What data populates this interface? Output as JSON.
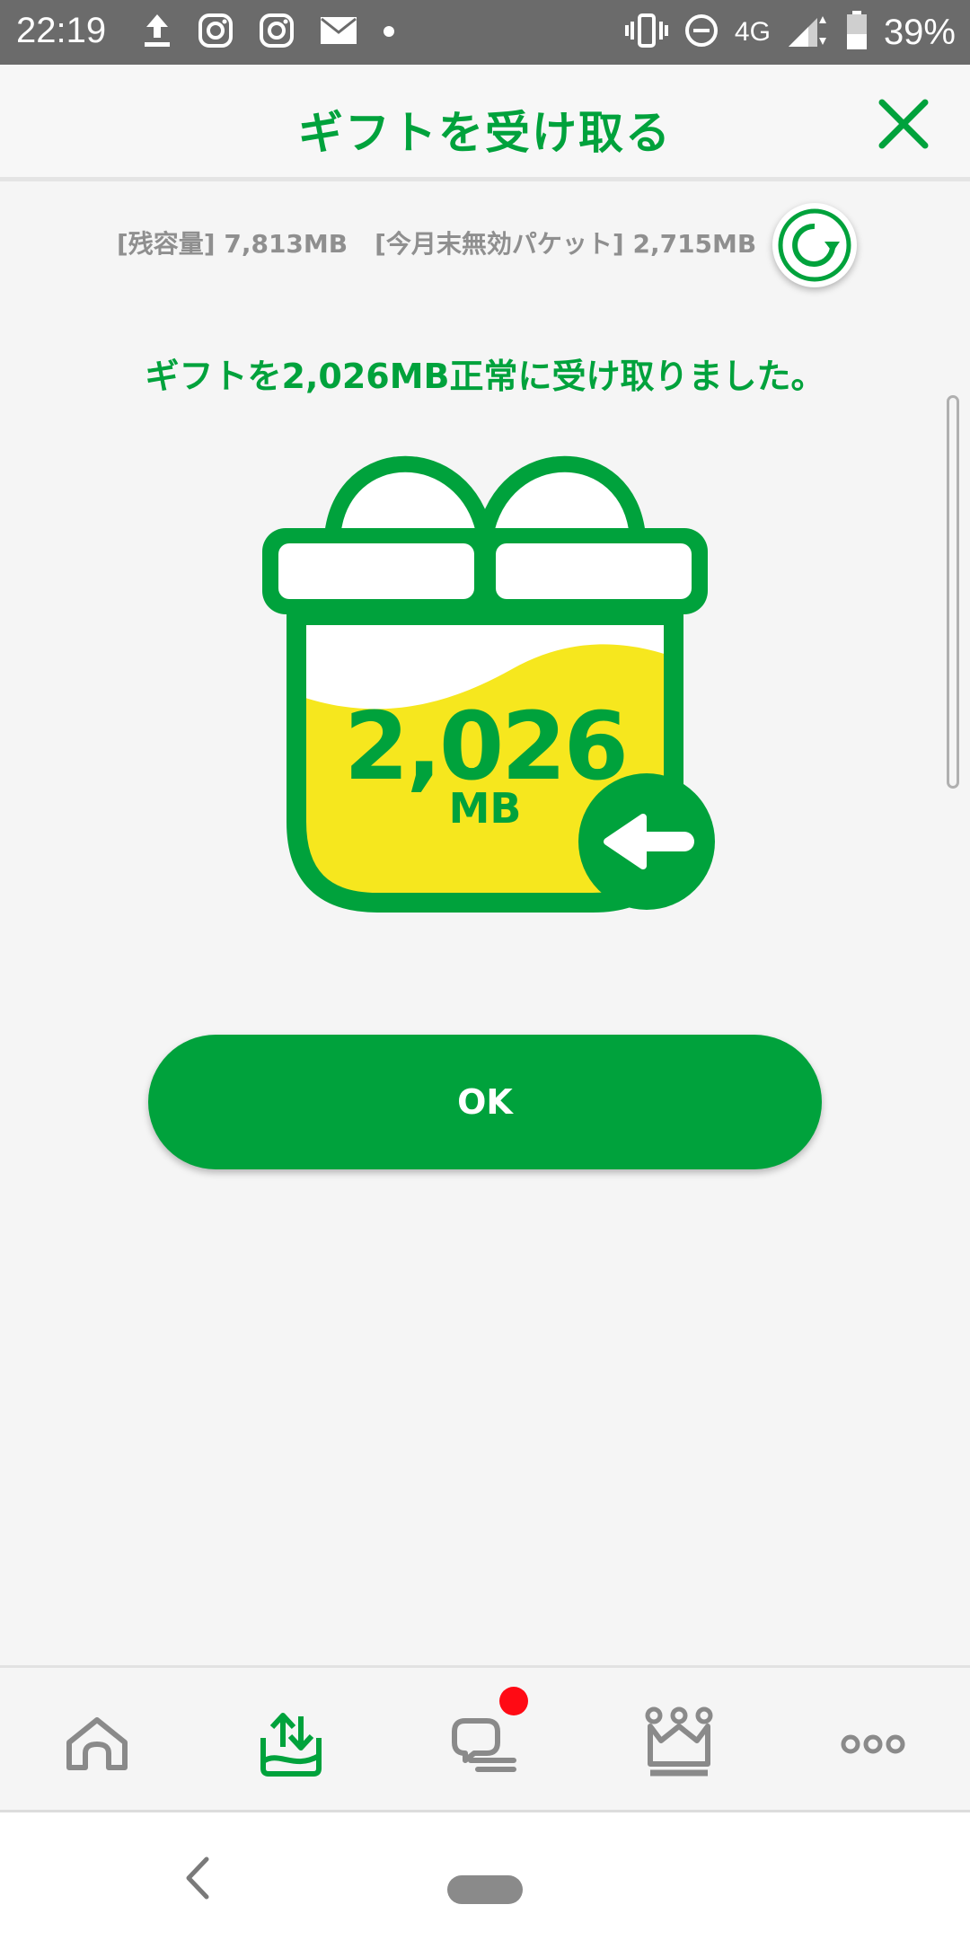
{
  "status_bar": {
    "time": "22:19",
    "network": "4G",
    "battery": "39%",
    "icons": [
      "upload-icon",
      "instagram-icon",
      "instagram-icon",
      "mail-icon",
      "dot-icon",
      "vibrate-icon",
      "do-not-disturb-icon",
      "signal-icon",
      "battery-icon"
    ]
  },
  "header": {
    "title": "ギフトを受け取る"
  },
  "info": {
    "remaining": "[残容量] 7,813MB",
    "expiring": "[今月末無効パケット] 2,715MB"
  },
  "message": "ギフトを2,026MB正常に受け取りました。",
  "gift": {
    "amount": "2,026",
    "unit": "MB"
  },
  "ok_button": "OK",
  "bottom_nav": {
    "items": [
      "home-icon",
      "gift-share-icon",
      "chat-icon",
      "ranking-icon",
      "more-icon"
    ],
    "active": "gift-share-icon"
  },
  "colors": {
    "brand_green": "#00a23c",
    "gift_yellow": "#f6e71e",
    "badge_red": "#ff0a14"
  }
}
